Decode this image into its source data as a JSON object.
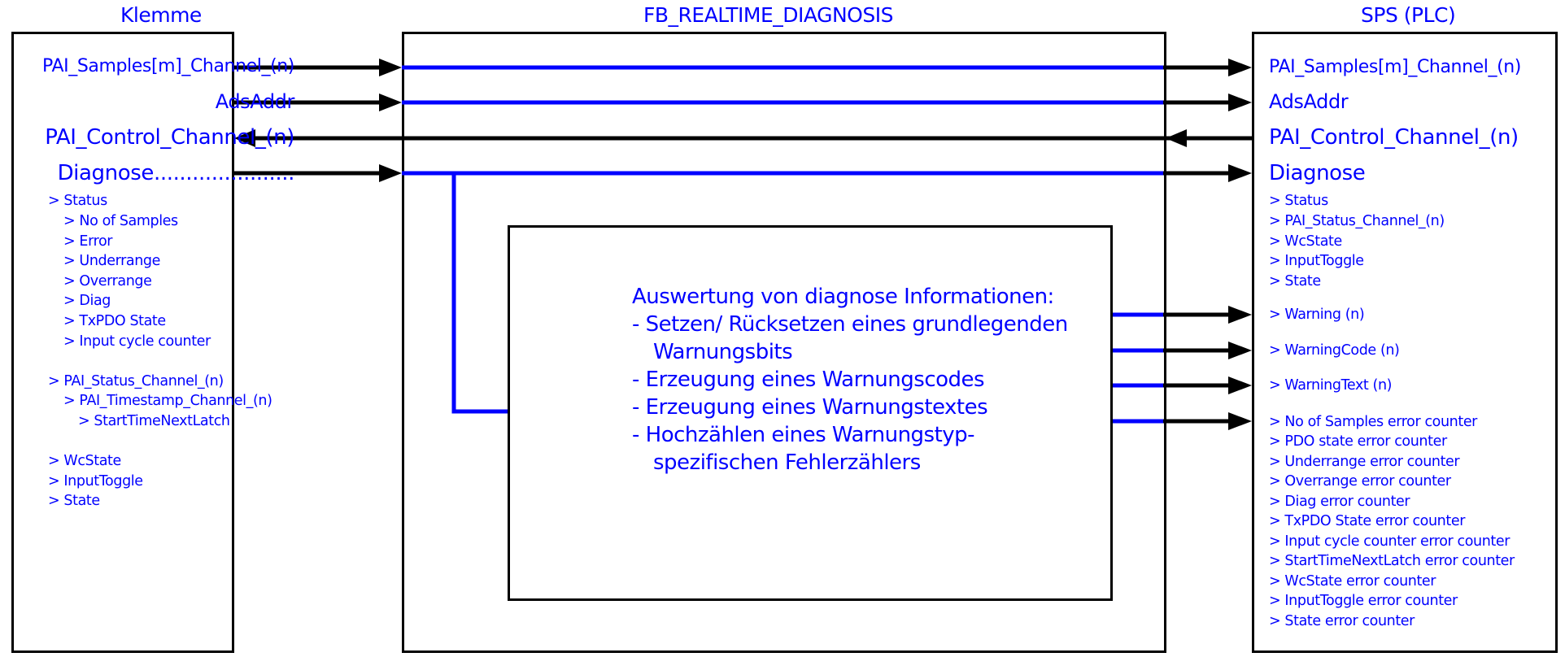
{
  "diagram": {
    "colors": {
      "text": "#0000ff",
      "wire_inside": "#0000ff",
      "wire_outside": "#000000",
      "box_border": "#000000"
    },
    "klemme": {
      "title": "Klemme",
      "signals": [
        {
          "label": "PAI_Samples[m]_Channel_(n)",
          "direction": "out"
        },
        {
          "label": "AdsAddr",
          "direction": "out"
        },
        {
          "label": "PAI_Control_Channel_(n)",
          "direction": "in"
        },
        {
          "label": "Diagnose......................",
          "direction": "out"
        }
      ],
      "diag_items": [
        {
          "label": "> Status",
          "level": 0
        },
        {
          "label": "> No of Samples",
          "level": 1
        },
        {
          "label": ">  Error",
          "level": 1
        },
        {
          "label": "> Underrange",
          "level": 1
        },
        {
          "label": "> Overrange",
          "level": 1
        },
        {
          "label": "> Diag",
          "level": 1
        },
        {
          "label": "> TxPDO State",
          "level": 1
        },
        {
          "label": ">  Input cycle counter",
          "level": 1
        },
        {
          "label": "> PAI_Status_Channel_(n)",
          "level": 0
        },
        {
          "label": "> PAI_Timestamp_Channel_(n)",
          "level": 1
        },
        {
          "label": "> StartTimeNextLatch",
          "level": 2
        },
        {
          "label": "> WcState",
          "level": 0
        },
        {
          "label": "> InputToggle",
          "level": 0
        },
        {
          "label": "> State",
          "level": 0
        }
      ]
    },
    "fb": {
      "title": "FB_REALTIME_DIAGNOSIS",
      "description": [
        "Auswertung von diagnose Informationen:",
        "- Setzen/ Rücksetzen eines grundlegenden",
        "   Warnungsbits",
        "- Erzeugung eines Warnungscodes",
        "- Erzeugung eines Warnungstextes",
        "- Hochzählen eines Warnungstyp-",
        "   spezifischen Fehlerzählers"
      ]
    },
    "sps": {
      "title": "SPS  (PLC)",
      "signals": [
        {
          "label": "PAI_Samples[m]_Channel_(n)"
        },
        {
          "label": "AdsAddr"
        },
        {
          "label": "PAI_Control_Channel_(n)"
        },
        {
          "label": "Diagnose"
        }
      ],
      "diag_items": [
        "> Status",
        "> PAI_Status_Channel_(n)",
        "> WcState",
        "> InputToggle",
        "> State"
      ],
      "warning_outputs": [
        "> Warning (n)",
        "> WarningCode (n)",
        "> WarningText (n)"
      ],
      "error_counters": [
        "> No of Samples error counter",
        "> PDO state error counter",
        "> Underrange error counter",
        "> Overrange error counter",
        "> Diag  error counter",
        "> TxPDO State  error counter",
        "> Input cycle counter error counter",
        "> StartTimeNextLatch error counter",
        "> WcState error counter",
        "> InputToggle error counter",
        "> State error counter"
      ]
    }
  }
}
